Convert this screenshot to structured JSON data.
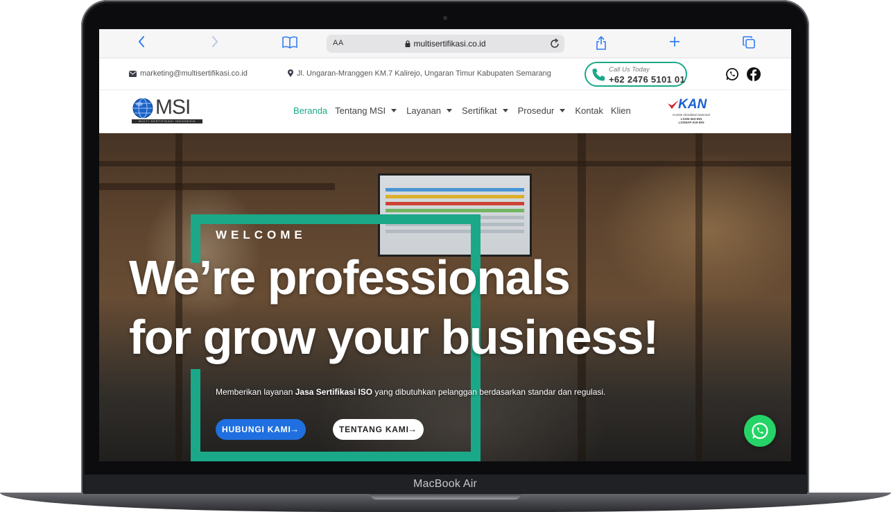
{
  "device": {
    "label": "MacBook Air"
  },
  "browser": {
    "text_size_label": "AA",
    "url": "multisertifikasi.co.id",
    "icons": {
      "back": "chevron-left-icon",
      "forward": "chevron-right-icon",
      "bookmarks": "book-icon",
      "lock": "lock-icon",
      "reload": "reload-icon",
      "share": "share-icon",
      "new_tab": "plus-icon",
      "tabs": "tabs-icon"
    }
  },
  "topbar": {
    "email": "marketing@multisertifikasi.co.id",
    "address": "Jl. Ungaran-Mranggen KM.7 Kalirejo, Ungaran Timur Kabupaten Semarang",
    "call_caption": "Call Us Today",
    "phone": "+62 2476 5101 01",
    "icons": {
      "email": "envelope-icon",
      "address": "map-pin-icon",
      "phone": "phone-icon",
      "whatsapp": "whatsapp-icon",
      "facebook": "facebook-icon"
    }
  },
  "nav": {
    "logo_text": "MSI",
    "logo_tagline": "MULTI SERTIFIKASI INDONESIA",
    "items": [
      {
        "label": "Beranda",
        "active": true,
        "dropdown": false
      },
      {
        "label": "Tentang MSI",
        "active": false,
        "dropdown": true
      },
      {
        "label": "Layanan",
        "active": false,
        "dropdown": true
      },
      {
        "label": "Sertifikat",
        "active": false,
        "dropdown": true
      },
      {
        "label": "Prosedur",
        "active": false,
        "dropdown": true
      },
      {
        "label": "Kontak",
        "active": false,
        "dropdown": false
      },
      {
        "label": "Klien",
        "active": false,
        "dropdown": false
      }
    ],
    "kan_logo": {
      "word": "KAN",
      "subtitle": "Komite Akreditasi Nasional",
      "codes": [
        "LSSM-363-IDN",
        "LSSMAP-019-IDN"
      ]
    }
  },
  "hero": {
    "eyebrow": "WELCOME",
    "headline_line1": "We’re professionals",
    "headline_line2": "for grow your business!",
    "sub_pre": "Memberikan layanan ",
    "sub_bold": "Jasa Sertifikasi ISO",
    "sub_post": " yang dibutuhkan pelanggan berdasarkan standar dan regulasi.",
    "primary_button": "HUBUNGI KAMI",
    "secondary_button": "TENTANG KAMI",
    "arrow": "→",
    "floating_icon": "whatsapp-icon"
  },
  "colors": {
    "accent": "#1aa888",
    "primary_button": "#1f6fe0",
    "safari_blue": "#2f7bf5",
    "whatsapp_green": "#25d366"
  }
}
